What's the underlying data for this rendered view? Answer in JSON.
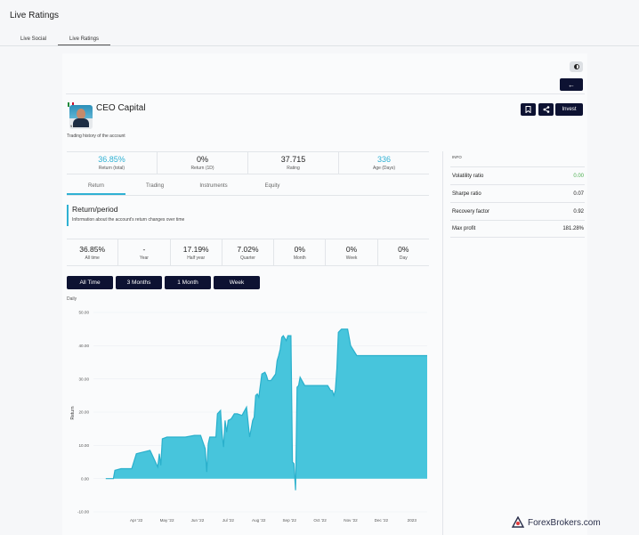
{
  "page": {
    "title": "Live Ratings"
  },
  "top_tabs": [
    {
      "label": "Live Social",
      "active": false
    },
    {
      "label": "Live Ratings",
      "active": true
    }
  ],
  "controls": {
    "back_arrow": "←"
  },
  "account": {
    "name": "CEO Capital",
    "subtitle": "Trading history of the account",
    "avatar_badge": "¥ 60",
    "flag_colors": [
      "#1f8a3b",
      "#ffffff",
      "#c8102e"
    ],
    "actions": {
      "invest": "Invest"
    }
  },
  "stats": [
    {
      "value": "36.85%",
      "label": "Return (total)",
      "accent": true
    },
    {
      "value": "0%",
      "label": "Return (1D)",
      "accent": false
    },
    {
      "value": "37.715",
      "label": "Rating",
      "accent": false
    },
    {
      "value": "336",
      "label": "Age (Days)",
      "accent": true
    }
  ],
  "sub_tabs": [
    {
      "label": "Return",
      "active": true
    },
    {
      "label": "Trading",
      "active": false
    },
    {
      "label": "Instruments",
      "active": false
    },
    {
      "label": "Equity",
      "active": false
    }
  ],
  "return_period": {
    "title": "Return/period",
    "description": "Information about the account's return changes over time"
  },
  "periods": [
    {
      "value": "36.85%",
      "label": "All time"
    },
    {
      "value": "-",
      "label": "Year"
    },
    {
      "value": "17.19%",
      "label": "Half year"
    },
    {
      "value": "7.02%",
      "label": "Quarter"
    },
    {
      "value": "0%",
      "label": "Month"
    },
    {
      "value": "0%",
      "label": "Week"
    },
    {
      "value": "0%",
      "label": "Day"
    }
  ],
  "range_buttons": [
    "All Time",
    "3 Months",
    "1 Month",
    "Week"
  ],
  "chart_caption": "Daily",
  "chart_data": {
    "type": "area",
    "title": "",
    "xlabel": "",
    "ylabel": "Return",
    "ylim": [
      -10,
      50
    ],
    "yticks": [
      "-10.00",
      "0.00",
      "10.00",
      "20.00",
      "30.00",
      "40.00",
      "50.00"
    ],
    "xtick_labels": [
      "Apr '22",
      "May '22",
      "Jun '22",
      "Jul '22",
      "Aug '22",
      "Sep '22",
      "Oct '22",
      "Nov '22",
      "Dec '22",
      "2023"
    ],
    "fill_color": "#47c5dc",
    "line_color": "#2ab0cc",
    "series": [
      {
        "x": [
          3.0,
          3.25,
          3.3,
          3.5,
          3.85,
          4.0,
          4.45,
          4.6,
          4.7,
          4.75,
          4.8,
          4.85,
          5.0,
          5.15,
          5.6,
          5.9,
          6.1,
          6.25,
          6.3,
          6.35,
          6.4,
          6.6,
          6.65,
          6.75,
          6.8,
          6.85,
          6.9,
          6.95,
          7.0,
          7.1,
          7.2,
          7.3,
          7.45,
          7.6,
          7.7,
          7.8,
          7.85,
          7.9,
          7.95,
          8.0,
          8.1,
          8.2,
          8.25,
          8.3,
          8.4,
          8.55,
          8.6,
          8.65,
          8.7,
          8.75,
          8.8,
          8.9,
          8.95,
          9.05,
          9.1,
          9.15,
          9.2,
          9.25,
          9.3,
          9.35,
          9.5,
          9.7,
          9.75,
          9.8,
          9.85,
          9.9,
          9.95,
          10.0,
          10.1,
          10.25,
          10.35,
          10.4,
          10.45,
          10.5,
          10.55,
          10.6,
          10.7,
          10.9,
          11.0,
          11.2,
          11.5,
          11.75,
          11.9,
          12.0,
          12.05,
          12.1,
          12.15,
          12.2,
          12.3,
          12.35,
          12.4,
          12.45,
          12.5,
          12.6,
          12.7,
          12.8,
          12.9,
          13.0,
          13.2,
          13.5
        ],
        "y": [
          0.0,
          0.0,
          2.5,
          3.0,
          3.0,
          7.5,
          8.5,
          5.5,
          3.5,
          7.5,
          4.0,
          12.0,
          12.5,
          12.5,
          12.5,
          13.0,
          13.0,
          9.0,
          2.0,
          10.5,
          12.5,
          12.5,
          19.5,
          20.5,
          13.5,
          9.5,
          17.5,
          14.0,
          17.5,
          18.0,
          19.5,
          19.5,
          19.0,
          21.5,
          12.5,
          17.5,
          18.5,
          25.0,
          25.5,
          24.5,
          31.5,
          32.0,
          31.0,
          29.5,
          29.5,
          31.5,
          35.5,
          37.0,
          39.0,
          42.5,
          43.0,
          41.5,
          43.0,
          43.0,
          5.0,
          4.5,
          -3.5,
          27.5,
          28.0,
          30.5,
          28.0,
          28.0,
          28.0,
          28.0,
          28.0,
          28.0,
          28.0,
          28.0,
          28.0,
          28.0,
          26.5,
          26.5,
          25.0,
          26.5,
          33.0,
          44.0,
          45.0,
          45.0,
          40.0,
          37.0,
          37.0,
          37.0,
          37.0,
          37.0,
          37.0,
          37.0,
          37.0,
          37.0,
          37.0,
          37.0,
          37.0,
          37.0,
          37.0,
          37.0,
          37.0,
          37.0,
          37.0,
          37.0,
          37.0,
          37.0
        ]
      }
    ]
  },
  "info": {
    "heading": "INFO",
    "rows": [
      {
        "label": "Volatility ratio",
        "value": "0.00",
        "positive": true
      },
      {
        "label": "Sharpe ratio",
        "value": "0.07",
        "positive": false
      },
      {
        "label": "Recovery factor",
        "value": "0.92",
        "positive": false
      },
      {
        "label": "Max profit",
        "value": "181.28%",
        "positive": false
      }
    ]
  },
  "watermark": {
    "text": "ForexBrokers.com"
  }
}
